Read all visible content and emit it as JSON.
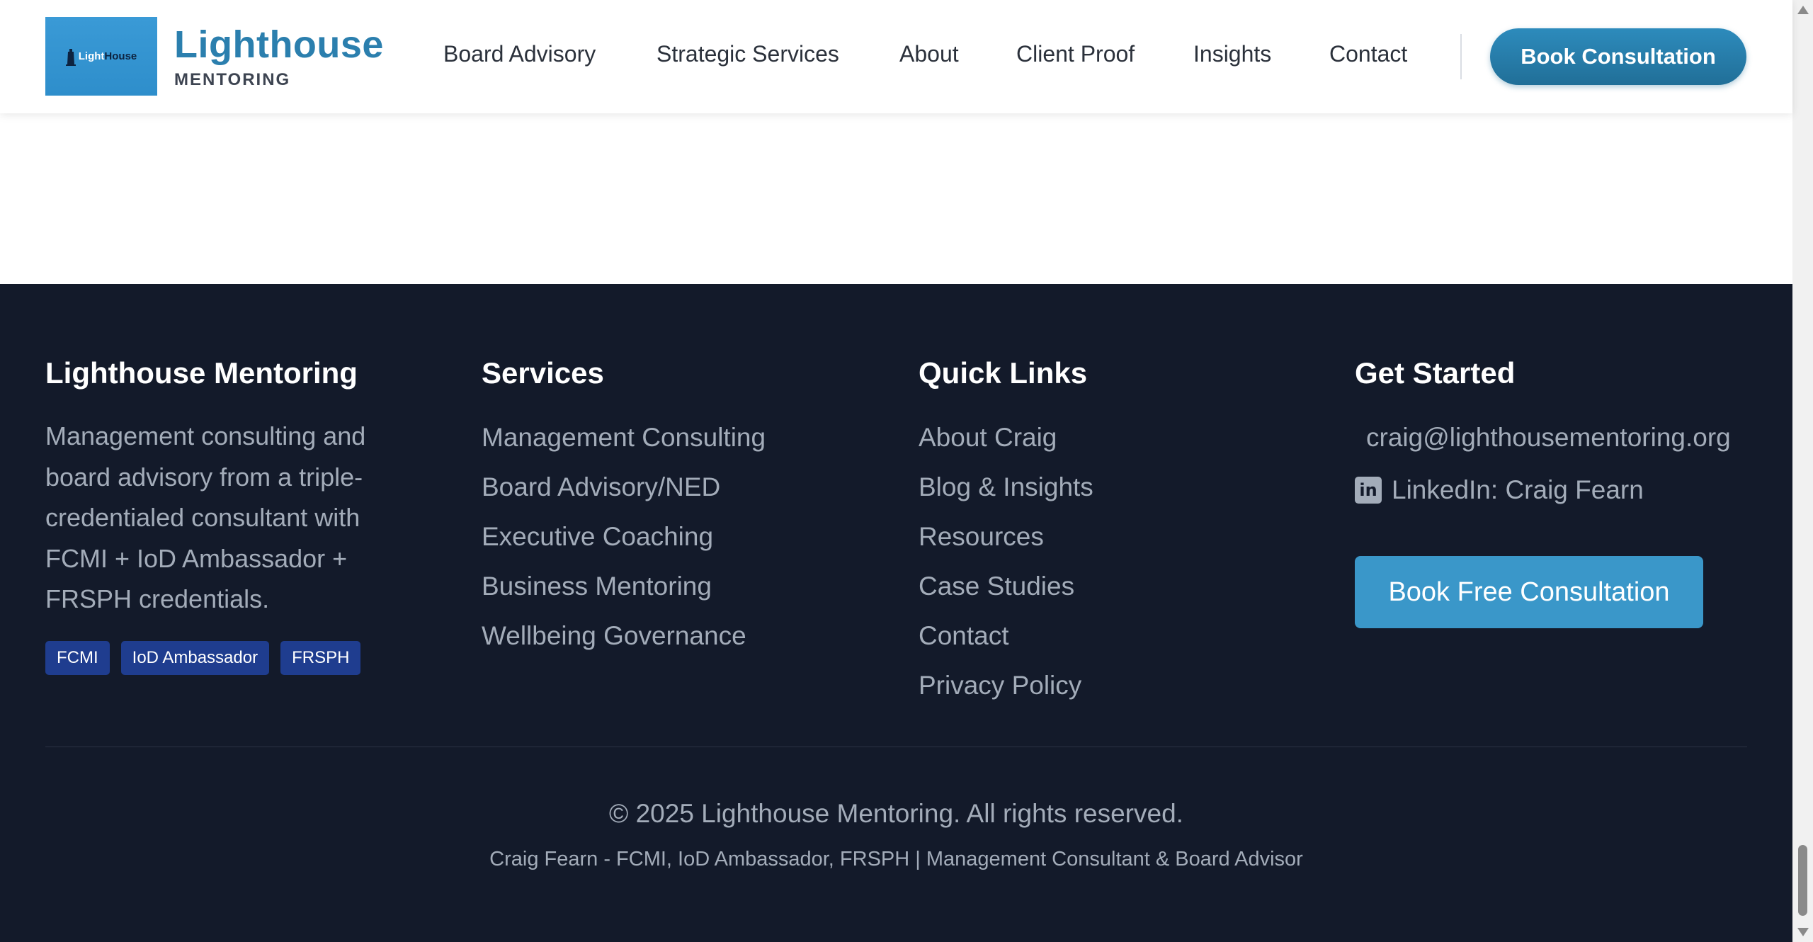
{
  "header": {
    "logo_image_text_a": "Light",
    "logo_image_text_b": "House",
    "logo_title": "Lighthouse",
    "logo_subtitle": "MENTORING",
    "nav": [
      "Board Advisory",
      "Strategic Services",
      "About",
      "Client Proof",
      "Insights",
      "Contact"
    ],
    "cta_label": "Book Consultation"
  },
  "footer": {
    "about": {
      "title": "Lighthouse Mentoring",
      "text": "Management consulting and board advisory from a triple-credentialed consultant with FCMI + IoD Ambassador + FRSPH credentials.",
      "badges": [
        "FCMI",
        "IoD Ambassador",
        "FRSPH"
      ]
    },
    "services": {
      "title": "Services",
      "items": [
        "Management Consulting",
        "Board Advisory/NED",
        "Executive Coaching",
        "Business Mentoring",
        "Wellbeing Governance"
      ]
    },
    "quick_links": {
      "title": "Quick Links",
      "items": [
        "About Craig",
        "Blog & Insights",
        "Resources",
        "Case Studies",
        "Contact",
        "Privacy Policy"
      ]
    },
    "get_started": {
      "title": "Get Started",
      "email": "craig@lighthousementoring.org",
      "linkedin_icon_glyph": "in",
      "linkedin_label": "LinkedIn: Craig Fearn",
      "cta_label": "Book Free Consultation"
    },
    "copyright": "© 2025 Lighthouse Mentoring. All rights reserved.",
    "credits": "Craig Fearn - FCMI, IoD Ambassador, FRSPH | Management Consultant & Board Advisor"
  },
  "colors": {
    "brand_blue": "#2b7fae",
    "footer_bg": "#131a2a",
    "badge_bg": "#1f3d8f",
    "cta_blue": "#3a97c9"
  },
  "icons": {
    "logo": "lighthouse-logo-icon",
    "linkedin": "linkedin-icon"
  }
}
